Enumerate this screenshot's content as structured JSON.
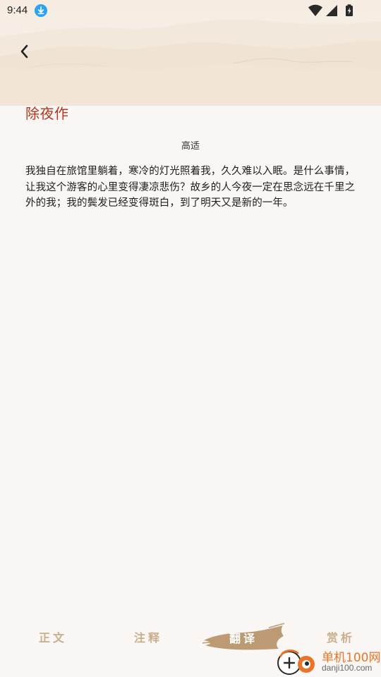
{
  "status_bar": {
    "time": "9:44",
    "icons": [
      "download-badge-icon",
      "wifi-icon",
      "signal-icon",
      "battery-charging-icon"
    ]
  },
  "header": {
    "back_icon": "chevron-left-icon"
  },
  "poem": {
    "title": "除夜作",
    "author": "高适",
    "translation": "我独自在旅馆里躺着，寒冷的灯光照着我，久久难以入眠。是什么事情，让我这个游客的心里变得凄凉悲伤？故乡的人今夜一定在思念远在千里之外的我；我的鬓发已经变得斑白，到了明天又是新的一年。"
  },
  "tabs": [
    {
      "label": "正文",
      "active": false
    },
    {
      "label": "注释",
      "active": false
    },
    {
      "label": "翻译",
      "active": true
    },
    {
      "label": "赏析",
      "active": false
    }
  ],
  "colors": {
    "title_red": "#b3361e",
    "tab_inactive": "#c9ae8c",
    "tab_active_brush": "#bb9a74",
    "background": "#f9f6f3"
  },
  "watermark": {
    "name": "单机100网",
    "url": "danji100.com"
  }
}
